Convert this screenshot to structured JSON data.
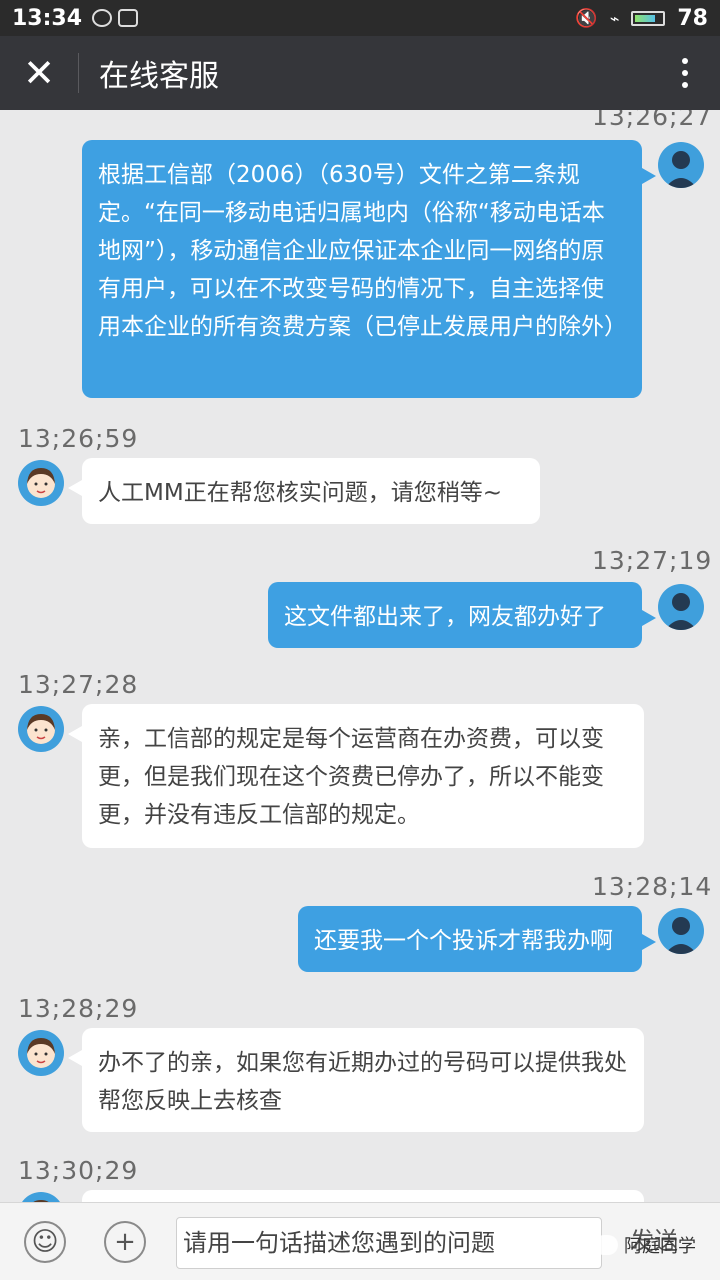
{
  "status_bar": {
    "time": "13:34",
    "battery": "78"
  },
  "header": {
    "title": "在线客服"
  },
  "messages": [
    {
      "id": "m1",
      "time": "13;26;27",
      "sender": "user",
      "text": "根据工信部（2006）（630号）文件之第二条规定。“在同一移动电话归属地内（俗称“移动电话本地网”），移动通信企业应保证本企业同一网络的原有用户，可以在不改变号码的情况下，自主选择使用本企业的所有资费方案（已停止发展用户的除外）"
    },
    {
      "id": "m2",
      "time": "13;26;59",
      "sender": "agent",
      "text": "人工MM正在帮您核实问题，请您稍等~"
    },
    {
      "id": "m3",
      "time": "13;27;19",
      "sender": "user",
      "text": "这文件都出来了，网友都办好了"
    },
    {
      "id": "m4",
      "time": "13;27;28",
      "sender": "agent",
      "text": "亲，工信部的规定是每个运营商在办资费，可以变更，但是我们现在这个资费已停办了，所以不能变更，并没有违反工信部的规定。"
    },
    {
      "id": "m5",
      "time": "13;28;14",
      "sender": "user",
      "text": "还要我一个个投诉才帮我办啊"
    },
    {
      "id": "m6",
      "time": "13;28;29",
      "sender": "agent",
      "text": "办不了的亲，如果您有近期办过的号码可以提供我处帮您反映上去核查"
    },
    {
      "id": "m7",
      "time": "13;30;29",
      "sender": "agent",
      "text": ""
    }
  ],
  "input": {
    "placeholder": "请用一句话描述您遇到的问题",
    "send_label": "发送"
  },
  "watermark": {
    "text": "阿庭同学"
  },
  "colors": {
    "accent": "#3ea0e2",
    "titlebar": "#35363a",
    "background": "#e9e9ea"
  }
}
